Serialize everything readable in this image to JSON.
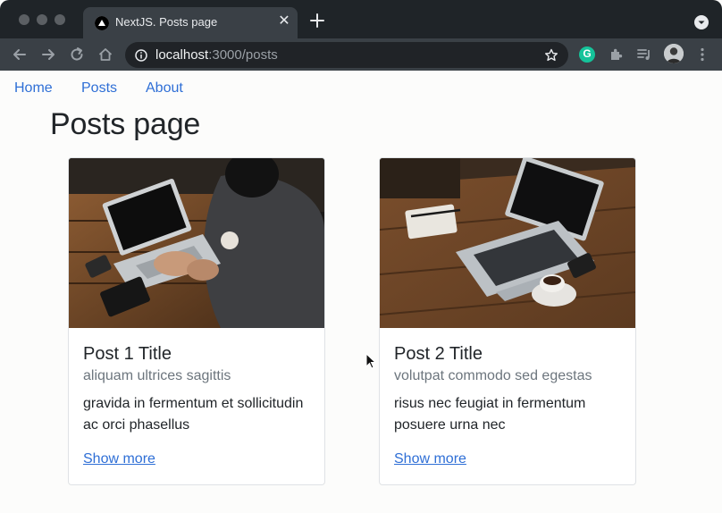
{
  "browser": {
    "tab_title": "NextJS. Posts page",
    "tab_close": "✕",
    "url_host": "localhost",
    "url_path": ":3000/posts",
    "extension_letter": "G"
  },
  "nav": {
    "items": [
      {
        "label": "Home"
      },
      {
        "label": "Posts"
      },
      {
        "label": "About"
      }
    ]
  },
  "page": {
    "title": "Posts page"
  },
  "posts": [
    {
      "title": "Post 1 Title",
      "subtitle": "aliquam ultrices sagittis",
      "text": "gravida in fermentum et sollicitudin ac orci phasellus",
      "link": "Show more"
    },
    {
      "title": "Post 2 Title",
      "subtitle": "volutpat commodo sed egestas",
      "text": "risus nec feugiat in fermentum posuere urna nec",
      "link": "Show more"
    }
  ],
  "colors": {
    "link": "#2f6fd6",
    "muted": "#6c757d",
    "chrome_dark": "#1f2428",
    "chrome_toolbar": "#3a4046"
  }
}
